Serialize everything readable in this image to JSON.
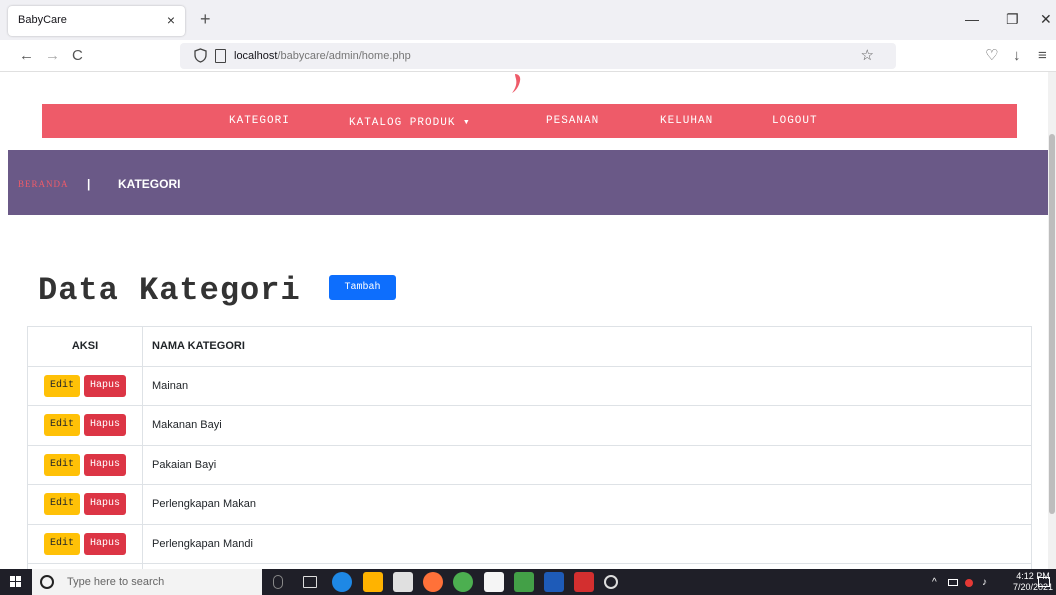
{
  "browser": {
    "tab_title": "BabyCare",
    "tab_close": "×",
    "new_tab": "+",
    "url_host": "localhost",
    "url_path": "/babycare/admin/home.php",
    "win_minimize": "—",
    "win_maximize": "❐",
    "win_close": "✕",
    "nav_back": "←",
    "nav_forward": "→",
    "nav_reload": "C",
    "bookmark_star": "☆",
    "pocket": "♡",
    "download": "↓",
    "menu": "≡"
  },
  "menu": {
    "kategori": "KATEGORI",
    "katalog": "KATALOG PRODUK",
    "katalog_caret": "▾",
    "pesanan": "PESANAN",
    "keluhan": "KELUHAN",
    "logout": "LOGOUT"
  },
  "breadcrumb": {
    "home": "BERANDA",
    "separator": "|",
    "current": "KATEGORI"
  },
  "page": {
    "title": "Data Kategori",
    "add_button": "Tambah"
  },
  "table": {
    "headers": [
      "AKSI",
      "NAMA KATEGORI"
    ],
    "edit_label": "Edit",
    "delete_label": "Hapus",
    "rows": [
      "Mainan",
      "Makanan Bayi",
      "Pakaian Bayi",
      "Perlengkapan Makan",
      "Perlengkapan Mandi",
      ""
    ]
  },
  "taskbar": {
    "search_placeholder": "Type here to search",
    "time": "4:12 PM",
    "date": "7/20/2021"
  },
  "colors": {
    "menu_bar": "#ee5b69",
    "hero_bar": "#6a5987",
    "primary": "#0d6efd",
    "warning": "#ffc107",
    "danger": "#dc3545"
  }
}
